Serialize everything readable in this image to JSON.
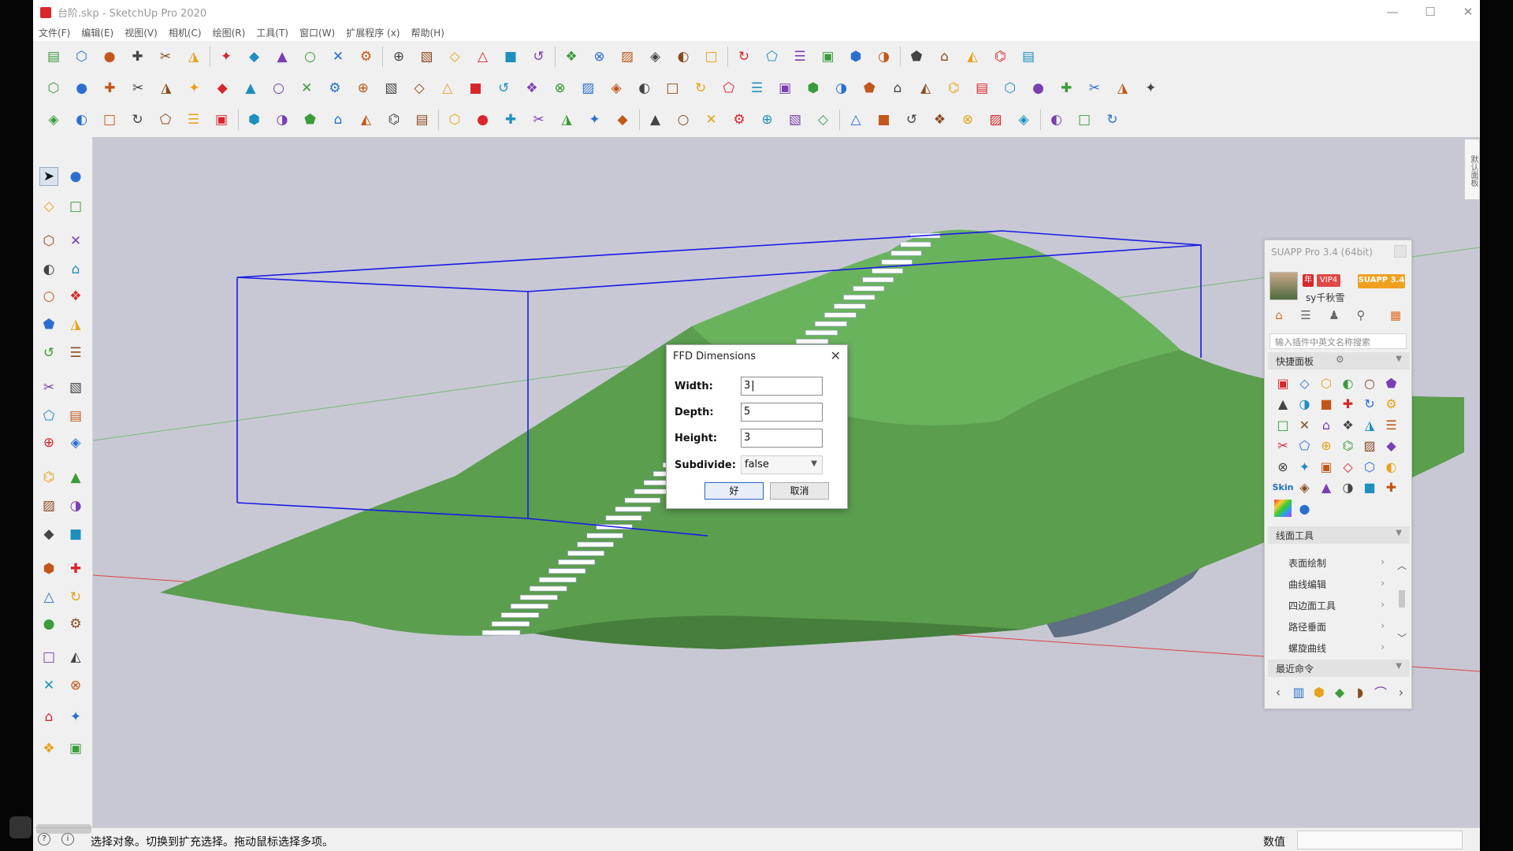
{
  "window": {
    "title": "台阶.skp - SketchUp Pro 2020",
    "controls": [
      "minimize-icon",
      "maximize-icon",
      "close-icon"
    ]
  },
  "menubar": [
    "文件(F)",
    "编辑(E)",
    "视图(V)",
    "相机(C)",
    "绘图(R)",
    "工具(T)",
    "窗口(W)",
    "扩展程序 (x)",
    "帮助(H)"
  ],
  "dialog": {
    "title": "FFD Dimensions",
    "fields": {
      "width": {
        "label": "Width:",
        "value": "3"
      },
      "depth": {
        "label": "Depth:",
        "value": "5"
      },
      "height": {
        "label": "Height:",
        "value": "3"
      },
      "subdivide": {
        "label": "Subdivide:",
        "value": "false"
      }
    },
    "ok_label": "好",
    "cancel_label": "取消"
  },
  "suapp": {
    "title": "SUAPP Pro 3.4 (64bit)",
    "badge_year": "年",
    "badge_vip": "VIP4",
    "badge_version": "SUAPP 3.4",
    "user": "sy千秋雪",
    "search_placeholder": "输入插件中英文名称搜索",
    "quick_panel": "快捷面板",
    "tools_section": "线面工具",
    "menu_items": [
      "表面绘制",
      "曲线编辑",
      "四边面工具",
      "路径垂面",
      "螺旋曲线"
    ],
    "recent_section": "最近命令",
    "skin_label": "Skin"
  },
  "side_tab": "默认面板",
  "status": {
    "text": "选择对象。切换到扩充选择。拖动鼠标选择多项。",
    "measure_label": "数值"
  },
  "colors": {
    "terrain": "#5b9e4e",
    "terrain_dark": "#467f3c",
    "ffd_cage": "#1a1ae6",
    "viewport_bg": "#c8c8d4",
    "accent_red": "#d8262b"
  }
}
